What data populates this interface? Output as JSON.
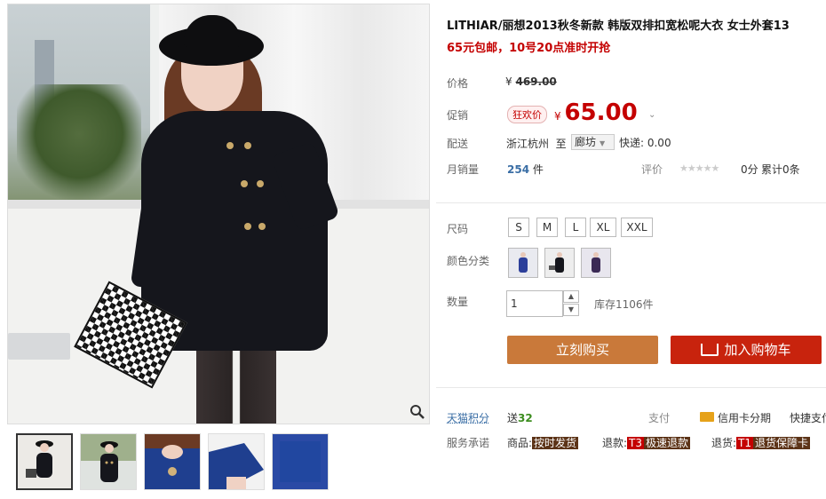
{
  "product": {
    "title": "LITHIAR/丽想2013秋冬新款 韩版双排扣宽松呢大衣 女士外套13",
    "subtitle": "65元包邮，10号20点准时开抢"
  },
  "price": {
    "label": "价格",
    "currency": "¥",
    "original": "469.00"
  },
  "promo": {
    "label": "促销",
    "badge": "狂欢价",
    "currency": "¥",
    "price": "65.00",
    "chevron": "⌄"
  },
  "shipping": {
    "label": "配送",
    "from": "浙江杭州",
    "to_word": "至",
    "destination": "廊坊",
    "express": "快递: 0.00"
  },
  "sales": {
    "label": "月销量",
    "count": "254",
    "unit": "件",
    "review_label": "评价",
    "stars": "★★★★★",
    "score": "0分",
    "total": "累计0条"
  },
  "size": {
    "label": "尺码",
    "options": [
      "S",
      "M",
      "L",
      "XL",
      "XXL"
    ]
  },
  "color": {
    "label": "颜色分类"
  },
  "quantity": {
    "label": "数量",
    "value": "1",
    "up": "▲",
    "down": "▼",
    "stock": "库存1106件"
  },
  "actions": {
    "buy_now": "立刻购买",
    "add_cart": "加入购物车"
  },
  "tmall": {
    "points_label": "天猫积分",
    "points_prefix": "送",
    "points_value": "32",
    "pay_label": "支付",
    "installment": "信用卡分期",
    "quick_pay": "快捷支付"
  },
  "service": {
    "label": "服务承诺",
    "goods_prefix": "商品:",
    "goods_tag": "按时发货",
    "refund_prefix": "退款:",
    "refund_code": "T3",
    "refund_tag": "极速退款",
    "return_prefix": "退货:",
    "return_code": "T1",
    "return_tag": "退货保障卡"
  },
  "colors": {
    "accent": "#c40000",
    "buy_button": "#c9793a",
    "cart_button": "#c8230d"
  },
  "icons": [
    "zoom-icon",
    "cart-icon",
    "credit-card-icon",
    "chevron-down-icon",
    "star-icon"
  ]
}
